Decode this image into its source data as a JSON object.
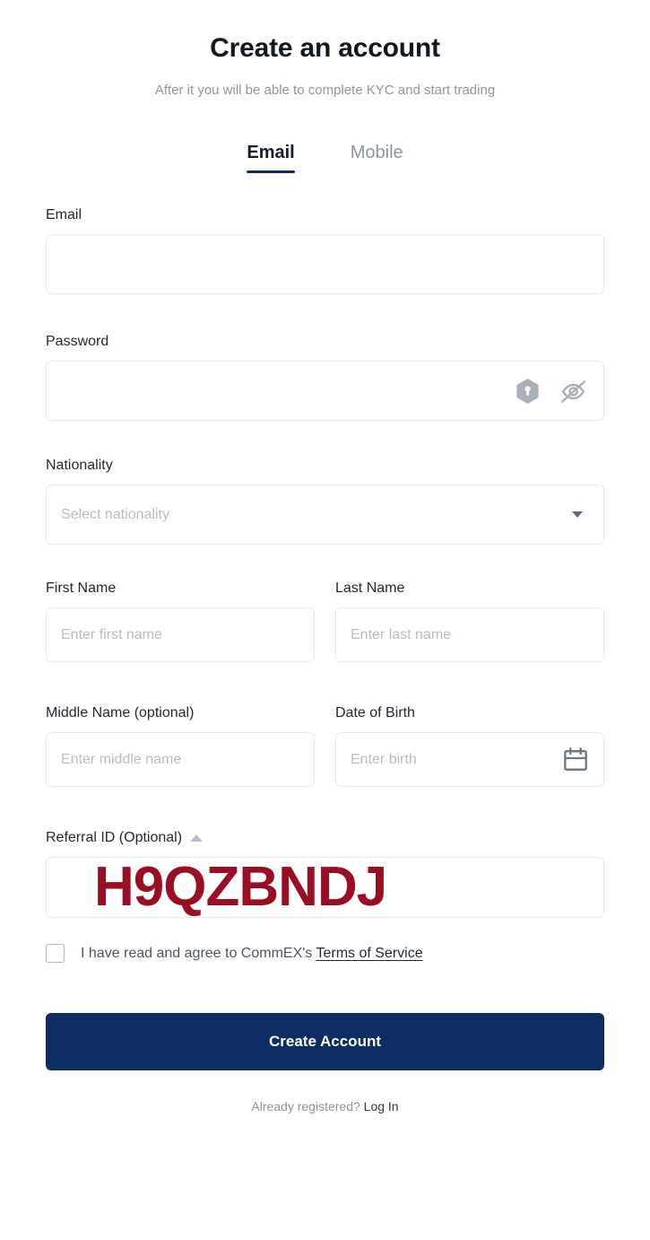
{
  "header": {
    "title": "Create an account",
    "subtitle": "After it you will be able to complete KYC and start trading"
  },
  "tabs": [
    {
      "label": "Email",
      "active": true
    },
    {
      "label": "Mobile",
      "active": false
    }
  ],
  "form": {
    "email": {
      "label": "Email",
      "value": "",
      "placeholder": ""
    },
    "password": {
      "label": "Password",
      "value": "",
      "placeholder": "",
      "icons": [
        "key-hexagon-icon",
        "eye-off-icon"
      ]
    },
    "nationality": {
      "label": "Nationality",
      "value": "",
      "placeholder": "Select nationality",
      "caret": "chevron-down-icon"
    },
    "first_name": {
      "label": "First Name",
      "value": "",
      "placeholder": "Enter first name"
    },
    "last_name": {
      "label": "Last Name",
      "value": "",
      "placeholder": "Enter last name"
    },
    "middle_name": {
      "label": "Middle Name (optional)",
      "value": "",
      "placeholder": "Enter middle name"
    },
    "date_of_birth": {
      "label": "Date of Birth",
      "value": "",
      "placeholder": "Enter birth",
      "icon": "calendar-icon"
    },
    "referral": {
      "label": "Referral ID (Optional)",
      "value": "H9QZBNDJ",
      "toggle_icon": "caret-up-icon"
    }
  },
  "terms": {
    "checked": false,
    "text_before": "I have read and agree to CommEX's",
    "link_label": "Terms of Service"
  },
  "submit": {
    "label": "Create Account"
  },
  "footer": {
    "text": "Already registered?",
    "link_label": "Log In"
  },
  "colors": {
    "brand_navy": "#0c2e63",
    "referral_red": "#9b0d21",
    "title": "#131722",
    "muted": "#8f96a3",
    "border": "#e9eaed"
  }
}
